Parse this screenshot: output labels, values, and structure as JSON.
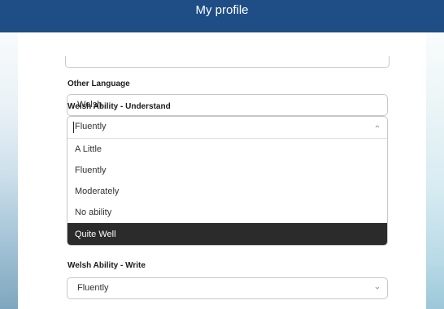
{
  "header": {
    "title": "My profile"
  },
  "other_language": {
    "label": "Other Language",
    "value": "Welsh"
  },
  "understand": {
    "label": "Welsh Ability - Understand",
    "value": "Fluently",
    "options": [
      "A Little",
      "Fluently",
      "Moderately",
      "No ability",
      "Quite Well"
    ],
    "highlighted_option": "Quite Well"
  },
  "write": {
    "label": "Welsh Ability - Write",
    "value": "Fluently"
  },
  "colors": {
    "header_bg": "#1f4e86",
    "highlight_bg": "#2b2b2b"
  }
}
